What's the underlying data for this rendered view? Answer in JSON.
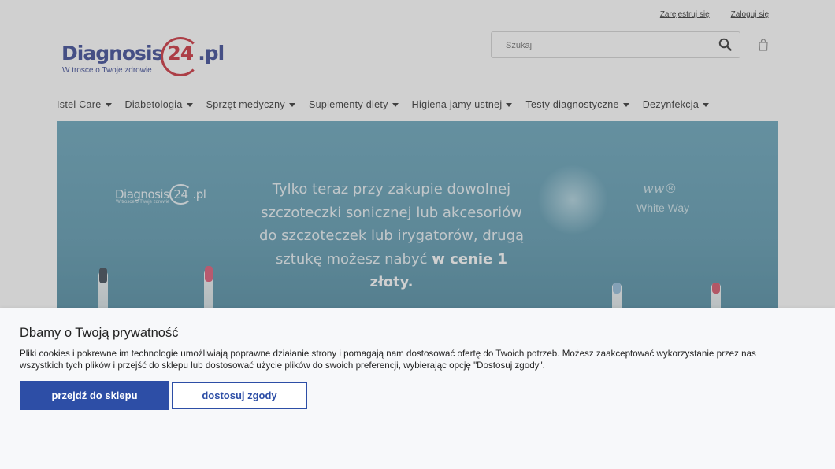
{
  "header": {
    "register_link": "Zarejestruj się",
    "login_link": "Zaloguj się",
    "logo": {
      "brand_prefix": "Diagnosis",
      "brand_number": "24",
      "brand_suffix": ".pl",
      "tagline": "W trosce o Twoje zdrowie"
    },
    "search": {
      "placeholder": "Szukaj",
      "icon": "search-icon"
    },
    "cart_icon": "shopping-bag-icon"
  },
  "nav": {
    "items": [
      {
        "label": "Istel Care"
      },
      {
        "label": "Diabetologia"
      },
      {
        "label": "Sprzęt medyczny"
      },
      {
        "label": "Suplementy diety"
      },
      {
        "label": "Higiena jamy ustnej"
      },
      {
        "label": "Testy diagnostyczne"
      },
      {
        "label": "Dezynfekcja"
      }
    ]
  },
  "banner": {
    "logo_prefix": "Diagnosis",
    "logo_number": "24",
    "logo_suffix": ".pl",
    "logo_tagline": "W trosce o Twoje zdrowie",
    "headline_lines": [
      "Tylko teraz przy zakupie dowolnej",
      "szczoteczki sonicznej lub akcesoriów",
      "do szczoteczek lub irygatorów, drugą"
    ],
    "headline_last_prefix": "sztukę możesz nabyć ",
    "headline_last_bold": "w cenie 1 złoty.",
    "partner_mark": "ww®",
    "partner_name": "White Way"
  },
  "cookie": {
    "title": "Dbamy o Twoją prywatność",
    "text": "Pliki cookies i pokrewne im technologie umożliwiają poprawne działanie strony i pomagają nam dostosować ofertę do Twoich potrzeb. Możesz zaakceptować wykorzystanie przez nas wszystkich tych plików i przejść do sklepu lub dostosować użycie plików do swoich preferencji, wybierając opcję \"Dostosuj zgody\".",
    "accept_button": "przejdź do sklepu",
    "customize_button": "dostosuj zgody"
  },
  "colors": {
    "brand_blue": "#2a3a8c",
    "brand_red": "#c81f2c",
    "button_blue": "#2d4ea6",
    "banner_teal": "#5b9db5"
  }
}
